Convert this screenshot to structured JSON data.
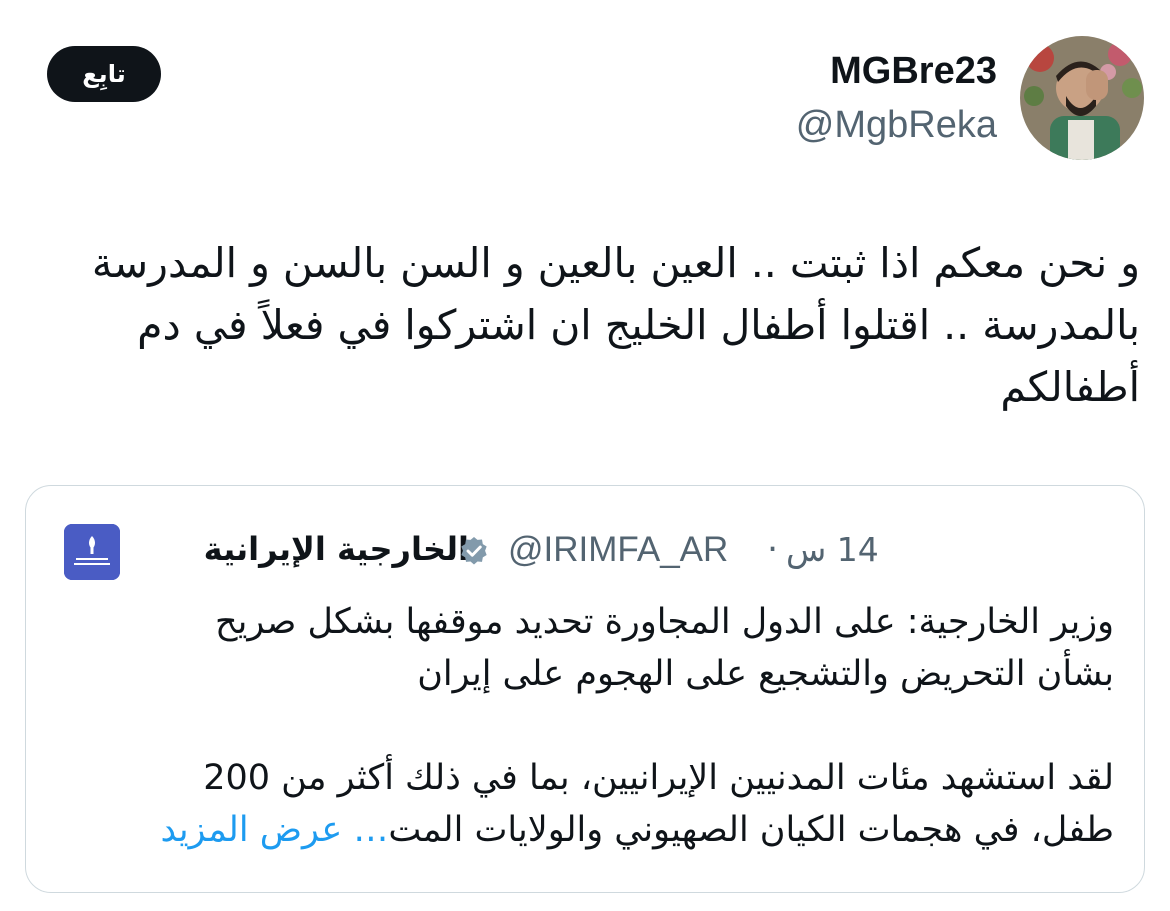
{
  "author": {
    "display_name": "MGBre23",
    "handle": "@MgbReka",
    "avatar_icon": "user-photo-avatar"
  },
  "follow_button": {
    "label": "تابِع"
  },
  "tweet": {
    "lines": [
      "و نحن معكم اذا ثبتت .. العين بالعين و السن بالسن و المدرسة",
      "بالمدرسة .. اقتلوا أطفال الخليج ان اشتركوا في فعلاً في دم",
      "أطفالكم"
    ]
  },
  "quote": {
    "display_name": "الخارجية الإيرانية",
    "handle": "@IRIMFA_AR",
    "separator": "·",
    "time": "14 س",
    "verified_icon": "verified-badge-icon",
    "logo_icon": "ministry-logo-icon",
    "paragraph1": [
      "وزير الخارجية: على الدول المجاورة تحديد موقفها بشكل صريح",
      "بشأن التحريض والتشجيع على الهجوم على إيران"
    ],
    "paragraph2_line1": "لقد استشهد مئات المدنيين الإيرانيين، بما في ذلك أكثر من 200",
    "paragraph2_line2": "طفل، في هجمات الكيان الصهيوني والولايات المت",
    "show_more": "… عرض المزيد"
  },
  "colors": {
    "text": "#0f1419",
    "secondary": "#536471",
    "link": "#1d9bf0",
    "border": "#cfd9de",
    "verified_gray": "#829aab"
  }
}
